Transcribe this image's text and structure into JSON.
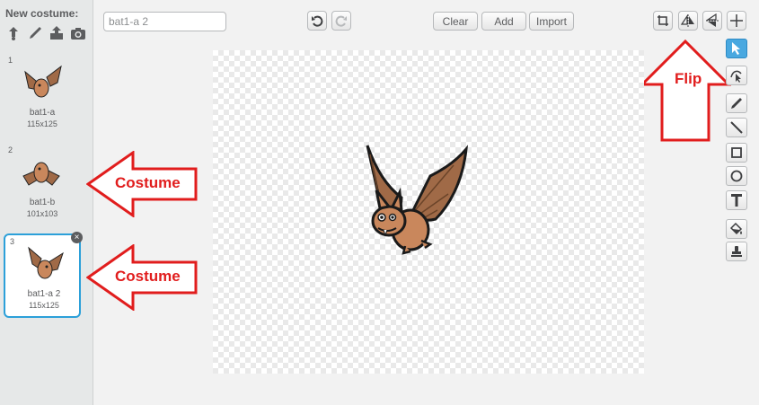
{
  "new_costume": {
    "label": "New costume:"
  },
  "costumes": [
    {
      "number": "1",
      "name": "bat1-a",
      "size": "115x125"
    },
    {
      "number": "2",
      "name": "bat1-b",
      "size": "101x103"
    },
    {
      "number": "3",
      "name": "bat1-a 2",
      "size": "115x125"
    }
  ],
  "costume_name_input": {
    "value": "bat1-a 2"
  },
  "toolbar": {
    "clear_label": "Clear",
    "add_label": "Add",
    "import_label": "Import"
  },
  "annotations": {
    "costume_1": "Costume",
    "costume_2": "Costume",
    "flip": "Flip"
  },
  "colors": {
    "selection": "#2ca0d9",
    "annotation": "#e11d1d",
    "bat_body": "#c9875c",
    "bat_wing": "#a06a47"
  }
}
